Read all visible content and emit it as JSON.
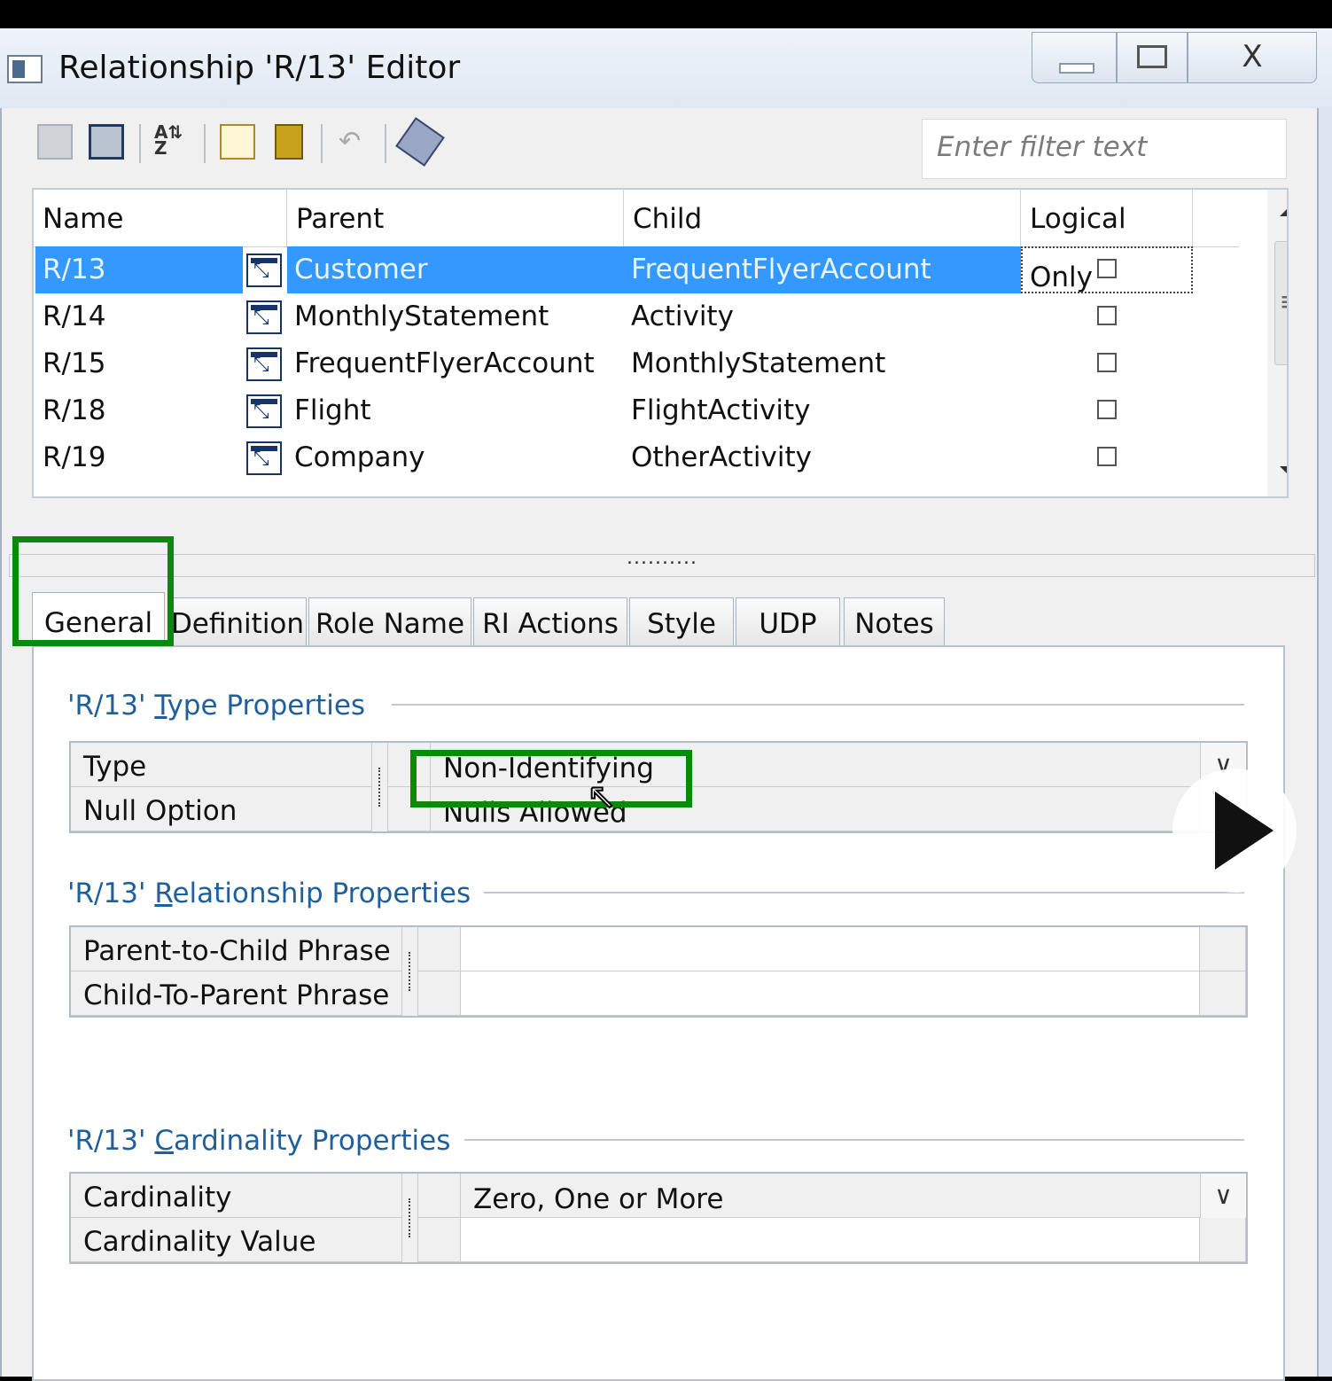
{
  "window": {
    "title": "Relationship 'R/13' Editor",
    "controls": {
      "close_glyph": "X"
    }
  },
  "toolbar": {
    "filter_placeholder": "Enter filter text",
    "icons": [
      "nav-prev-icon",
      "nav-next-icon",
      "sort-az-icon",
      "new-icon",
      "delete-icon",
      "undo-icon",
      "properties-icon"
    ]
  },
  "grid": {
    "columns": [
      "Name",
      "Parent",
      "Child",
      "Logical Only"
    ],
    "rows": [
      {
        "name": "R/13",
        "parent": "Customer",
        "child": "FrequentFlyerAccount",
        "logical_only": false,
        "selected": true
      },
      {
        "name": "R/14",
        "parent": "MonthlyStatement",
        "child": "Activity",
        "logical_only": false
      },
      {
        "name": "R/15",
        "parent": "FrequentFlyerAccount",
        "child": "MonthlyStatement",
        "logical_only": false
      },
      {
        "name": "R/18",
        "parent": "Flight",
        "child": "FlightActivity",
        "logical_only": false
      },
      {
        "name": "R/19",
        "parent": "Company",
        "child": "OtherActivity",
        "logical_only": false
      }
    ]
  },
  "splitter_glyph": "..........",
  "tabs": [
    "General",
    "Definition",
    "Role Name",
    "RI Actions",
    "Style",
    "UDP",
    "Notes"
  ],
  "active_tab": "General",
  "sections": {
    "type": {
      "title_prefix": "'R/13' ",
      "title_accel": "T",
      "title_rest": "ype Properties",
      "rows": [
        {
          "label": "Type",
          "value": "Non-Identifying"
        },
        {
          "label": "Null Option",
          "value": "Nulls Allowed"
        }
      ]
    },
    "relationship": {
      "title_prefix": "'R/13' ",
      "title_accel": "R",
      "title_rest": "elationship Properties",
      "rows": [
        {
          "label": "Parent-to-Child Phrase",
          "value": ""
        },
        {
          "label": "Child-To-Parent Phrase",
          "value": ""
        }
      ]
    },
    "cardinality": {
      "title_prefix": "'R/13' ",
      "title_accel": "C",
      "title_rest": "ardinality Properties",
      "rows": [
        {
          "label": "Cardinality",
          "value": "Zero, One or More"
        },
        {
          "label": "Cardinality Value",
          "value": ""
        }
      ]
    }
  },
  "colors": {
    "selection": "#3399ff",
    "section_title": "#1f5f9c",
    "highlight_box": "#0a8a0a"
  },
  "dropdown_glyph": "∨"
}
